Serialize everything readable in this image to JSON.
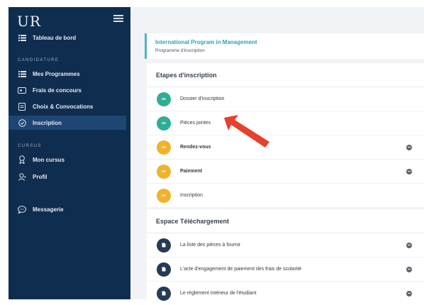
{
  "brand": {
    "logo_text": "UR"
  },
  "sidebar": {
    "dashboard": {
      "label": "Tableau de bord",
      "icon": "list-icon"
    },
    "section_candidature": "CANDIDATURE",
    "items": [
      {
        "label": "Mes Programmes",
        "icon": "list-icon"
      },
      {
        "label": "Frais de concours",
        "icon": "payment-icon"
      },
      {
        "label": "Choix & Convocations",
        "icon": "document-icon"
      },
      {
        "label": "Inscription",
        "icon": "check-circle-icon",
        "active": true
      }
    ],
    "section_cursus": "CURSUS",
    "cursus_items": [
      {
        "label": "Mon cursus",
        "icon": "award-icon"
      },
      {
        "label": "Profil",
        "icon": "user-icon"
      }
    ],
    "messaging": {
      "label": "Messagerie",
      "icon": "chat-icon"
    }
  },
  "program": {
    "title": "International Program in Management",
    "subtitle": "Programme d'inscription"
  },
  "etapes": {
    "header": "Etapes d'inscription",
    "steps": [
      {
        "label": "Dossier d'inscription",
        "status_color": "#2fae94",
        "has_toggle": false
      },
      {
        "label": "Pièces jointes",
        "status_color": "#2fae94",
        "has_toggle": false
      },
      {
        "label": "Rendez-vous",
        "status_color": "#f0b329",
        "has_toggle": true
      },
      {
        "label": "Paiement",
        "status_color": "#f0b329",
        "has_toggle": true
      },
      {
        "label": "Inscription",
        "status_color": "#f0b329",
        "has_toggle": false
      }
    ]
  },
  "downloads": {
    "header": "Espace Téléchargement",
    "items": [
      {
        "label": "La liste des pièces à fournir"
      },
      {
        "label": "L'acte d'engagement de paiement des frais de scolarité"
      },
      {
        "label": "Le règlement intérieur de l'étudiant"
      }
    ]
  },
  "colors": {
    "sidebar_bg": "#0f2d4f",
    "accent_teal": "#2aa4b8",
    "status_done": "#2fae94",
    "status_pending": "#f0b329",
    "arrow_red": "#e8402a"
  }
}
